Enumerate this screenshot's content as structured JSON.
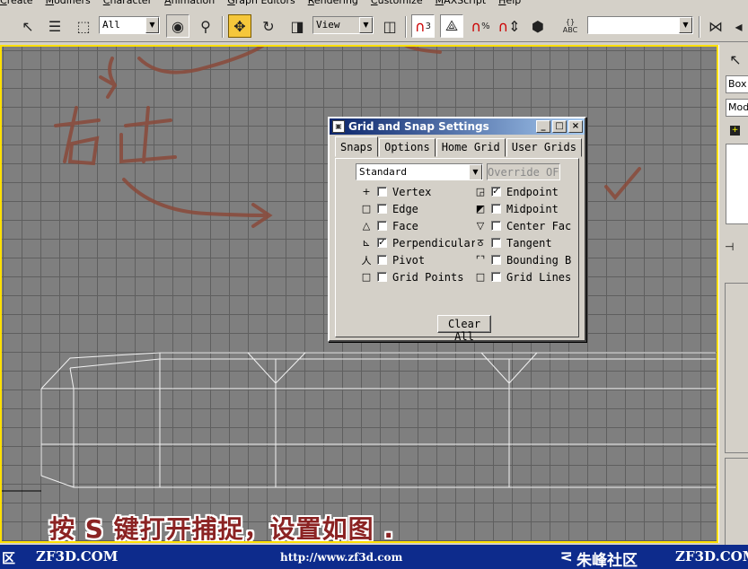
{
  "menu": [
    "Create",
    "Modifiers",
    "Character",
    "Animation",
    "Graph Editors",
    "Rendering",
    "Customize",
    "MAXScript",
    "Help"
  ],
  "toolbar": {
    "selection_filter": "All",
    "ref_coord": "View",
    "named_selection": "",
    "snap_toggle_label": "3",
    "angle_snap_label": "",
    "percent_snap_label": "%",
    "spinner_snap_label": "",
    "abc_label": "ABC"
  },
  "command_panel": {
    "object_type": "Box",
    "modifier": "Mod",
    "plus": "+"
  },
  "dialog": {
    "title": "Grid and Snap Settings",
    "tabs": [
      "Snaps",
      "Options",
      "Home Grid",
      "User Grids"
    ],
    "mode": "Standard",
    "override": "Override OFF",
    "snaps_left": [
      {
        "icon": "vertex-snap-icon",
        "glyph": "+",
        "label": "Vertex",
        "checked": false
      },
      {
        "icon": "edge-snap-icon",
        "glyph": "□",
        "label": "Edge",
        "checked": false
      },
      {
        "icon": "face-snap-icon",
        "glyph": "△",
        "label": "Face",
        "checked": false
      },
      {
        "icon": "perpendicular-snap-icon",
        "glyph": "⊾",
        "label": "Perpendicular",
        "checked": true
      },
      {
        "icon": "pivot-snap-icon",
        "glyph": "人",
        "label": "Pivot",
        "checked": false
      },
      {
        "icon": "grid-points-snap-icon",
        "glyph": "□",
        "label": "Grid Points",
        "checked": false
      }
    ],
    "snaps_right": [
      {
        "icon": "endpoint-snap-icon",
        "glyph": "◲",
        "label": "Endpoint",
        "checked": true
      },
      {
        "icon": "midpoint-snap-icon",
        "glyph": "◩",
        "label": "Midpoint",
        "checked": false
      },
      {
        "icon": "center-face-snap-icon",
        "glyph": "▽",
        "label": "Center Face",
        "checked": false
      },
      {
        "icon": "tangent-snap-icon",
        "glyph": "ठ",
        "label": "Tangent",
        "checked": false
      },
      {
        "icon": "bounding-box-snap-icon",
        "glyph": "⌜⌝",
        "label": "Bounding Box",
        "checked": false
      },
      {
        "icon": "grid-lines-snap-icon",
        "glyph": "□",
        "label": "Grid Lines",
        "checked": false
      }
    ],
    "clear_all": "Clear All"
  },
  "caption": "按 S 键打开捕捉，设置如图 .",
  "banner": {
    "left_cut": "区",
    "site_left": "ZF3D.COM",
    "url": "http://www.zf3d.com",
    "community": "朱峰社区",
    "site_right": "ZF3D.COM"
  },
  "colors": {
    "accent": "#f5c73b",
    "viewport": "#7f7f7f",
    "banner": "#0d2b8c",
    "caption": "#8b2323"
  }
}
